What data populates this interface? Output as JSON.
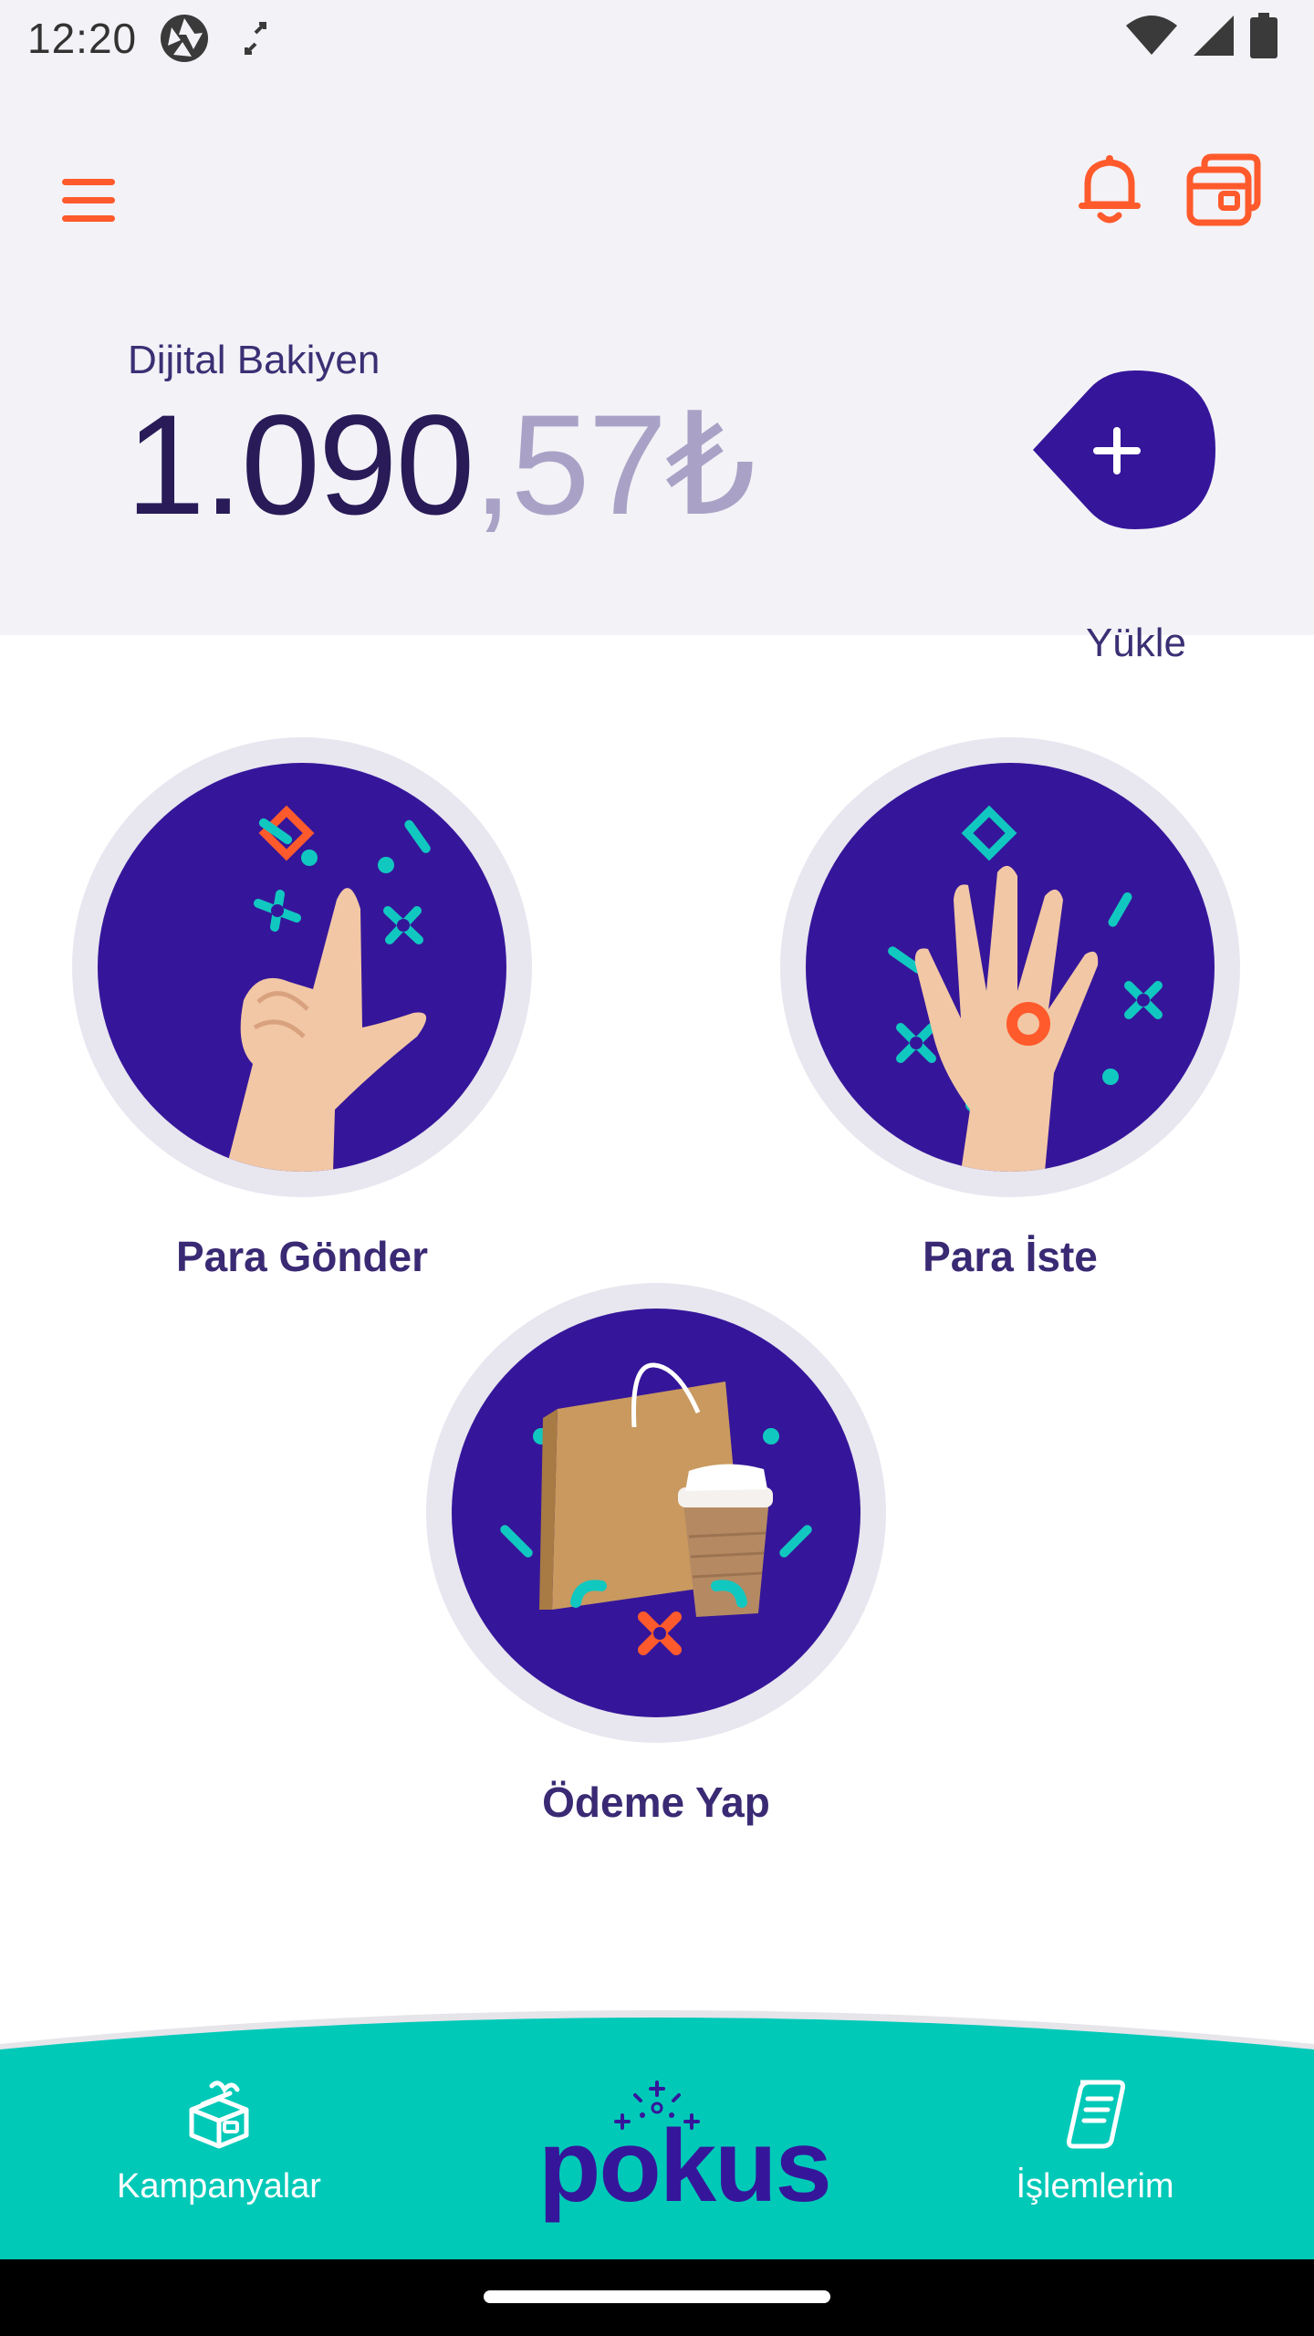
{
  "status_bar": {
    "time": "12:20"
  },
  "header": {
    "menu_icon": "hamburger-menu-icon",
    "bell_icon": "bell-icon",
    "cards_icon": "cards-icon"
  },
  "balance": {
    "label": "Dijital Bakiyen",
    "whole": "1.090",
    "decimal": ",57₺"
  },
  "load": {
    "label": "Yükle",
    "icon": "plus-icon"
  },
  "actions": [
    {
      "label": "Para Gönder",
      "icon": "hand-send-illustration"
    },
    {
      "label": "Para İste",
      "icon": "hand-request-illustration"
    },
    {
      "label": "Ödeme Yap",
      "icon": "shopping-bag-coffee-illustration"
    }
  ],
  "bottom_nav": {
    "campaigns": {
      "label": "Kampanyalar",
      "icon": "gift-box-icon"
    },
    "logo": "pokus",
    "transactions": {
      "label": "İşlemlerim",
      "icon": "receipt-scroll-icon"
    }
  },
  "colors": {
    "accent_orange": "#ff5a2c",
    "brand_purple": "#35169a",
    "teal": "#00c9b8",
    "background": "#f3f2f7"
  }
}
